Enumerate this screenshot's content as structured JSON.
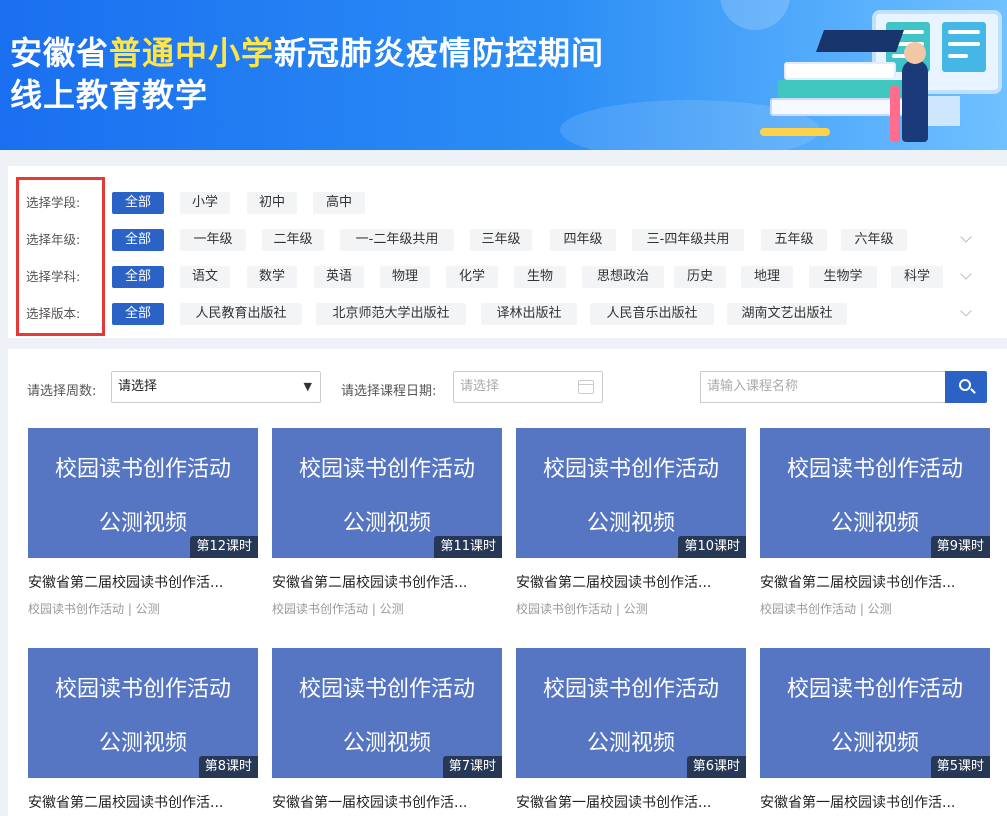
{
  "banner": {
    "title_part1": "安徽省",
    "title_highlight": "普通中小学",
    "title_part2": "新冠肺炎疫情防控期间",
    "title_line2": "线上教育教学"
  },
  "filters": {
    "stage": {
      "label": "选择学段:",
      "options": [
        "全部",
        "小学",
        "初中",
        "高中"
      ]
    },
    "grade": {
      "label": "选择年级:",
      "options": [
        "全部",
        "一年级",
        "二年级",
        "一-二年级共用",
        "三年级",
        "四年级",
        "三-四年级共用",
        "五年级",
        "六年级"
      ]
    },
    "subject": {
      "label": "选择学科:",
      "options": [
        "全部",
        "语文",
        "数学",
        "英语",
        "物理",
        "化学",
        "生物",
        "思想政治",
        "历史",
        "地理",
        "生物学",
        "科学"
      ]
    },
    "publisher": {
      "label": "选择版本:",
      "options": [
        "全部",
        "人民教育出版社",
        "北京师范大学出版社",
        "译林出版社",
        "人民音乐出版社",
        "湖南文艺出版社"
      ]
    }
  },
  "controls": {
    "week_label": "请选择周数:",
    "week_value": "请选择",
    "date_label": "请选择课程日期:",
    "date_placeholder": "请选择",
    "search_placeholder": "请输入课程名称"
  },
  "cards": [
    {
      "thumb_line1": "校园读书创作活动",
      "thumb_line2": "公测视频",
      "badge": "第12课时",
      "title": "安徽省第二届校园读书创作活...",
      "meta": "校园读书创作活动 | 公测"
    },
    {
      "thumb_line1": "校园读书创作活动",
      "thumb_line2": "公测视频",
      "badge": "第11课时",
      "title": "安徽省第二届校园读书创作活...",
      "meta": "校园读书创作活动 | 公测"
    },
    {
      "thumb_line1": "校园读书创作活动",
      "thumb_line2": "公测视频",
      "badge": "第10课时",
      "title": "安徽省第二届校园读书创作活...",
      "meta": "校园读书创作活动 | 公测"
    },
    {
      "thumb_line1": "校园读书创作活动",
      "thumb_line2": "公测视频",
      "badge": "第9课时",
      "title": "安徽省第二届校园读书创作活...",
      "meta": "校园读书创作活动 | 公测"
    },
    {
      "thumb_line1": "校园读书创作活动",
      "thumb_line2": "公测视频",
      "badge": "第8课时",
      "title": "安徽省第二届校园读书创作活..."
    },
    {
      "thumb_line1": "校园读书创作活动",
      "thumb_line2": "公测视频",
      "badge": "第7课时",
      "title": "安徽省第一届校园读书创作活..."
    },
    {
      "thumb_line1": "校园读书创作活动",
      "thumb_line2": "公测视频",
      "badge": "第6课时",
      "title": "安徽省第一届校园读书创作活..."
    },
    {
      "thumb_line1": "校园读书创作活动",
      "thumb_line2": "公测视频",
      "badge": "第5课时",
      "title": "安徽省第一届校园读书创作活..."
    }
  ],
  "colors": {
    "accent": "#2a62c5",
    "thumb": "#5675c2",
    "highlight": "#ffe54a",
    "annotation": "#e53935"
  }
}
